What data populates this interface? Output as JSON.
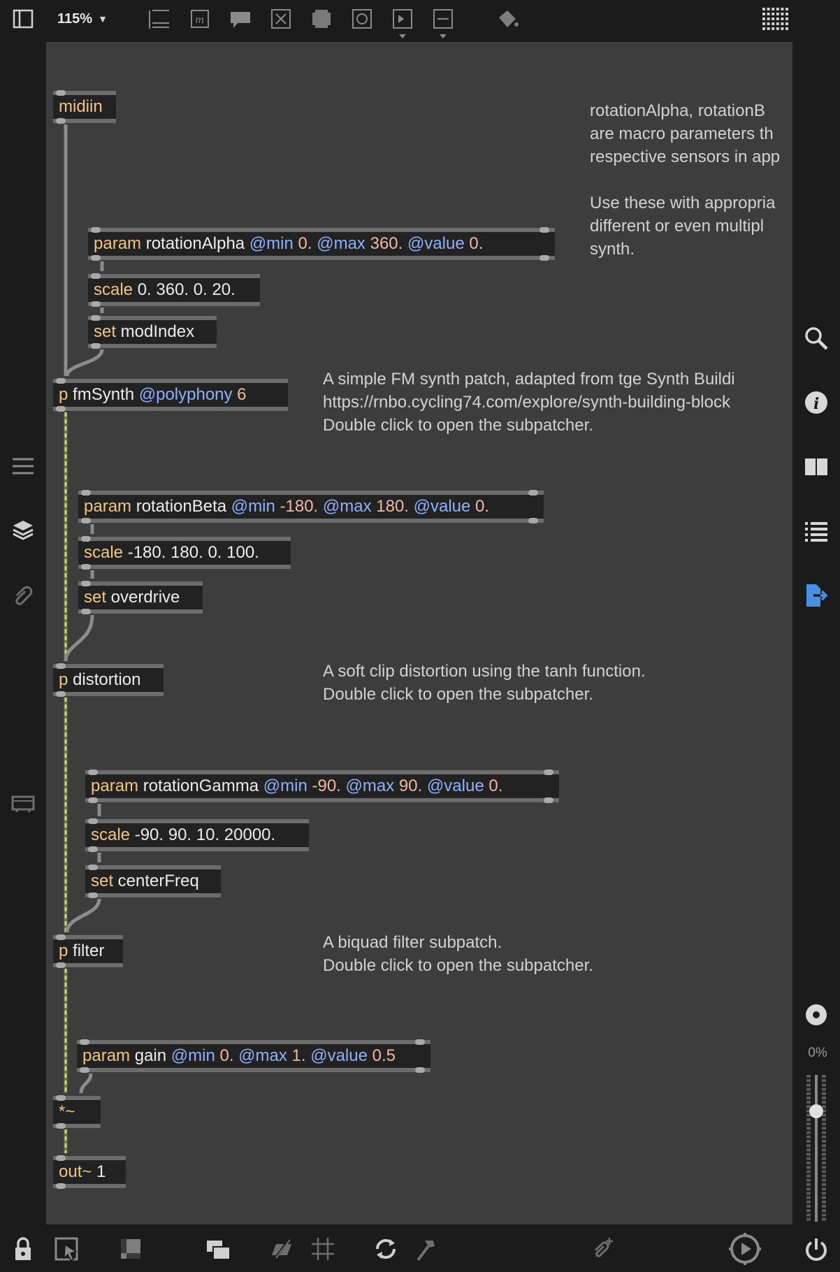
{
  "toolbar": {
    "zoom_label": "115%",
    "zoom_caret": "▼",
    "icons": [
      "sidebar-toggle-icon",
      "presentation-icon",
      "message-icon",
      "comment-icon",
      "button-icon",
      "toggle-icon",
      "number-box-icon",
      "play-icon",
      "slider-icon",
      "paint-bucket-icon",
      "grid-menu-icon"
    ]
  },
  "left_sidebar": {
    "icons": [
      "list-icon",
      "layers-icon",
      "attach-icon",
      "device-icon"
    ]
  },
  "right_sidebar": {
    "icons": [
      "search-icon",
      "info-icon",
      "book-icon",
      "list-icon",
      "export-icon",
      "record-icon"
    ],
    "meter_label": "0%"
  },
  "bottombar": {
    "icons": [
      "lock-icon",
      "pointer-icon",
      "present-icon",
      "stack-icon",
      "hide-icon",
      "grid-icon",
      "refresh-icon",
      "hammer-icon",
      "clip-icon",
      "audio-icon",
      "power-icon"
    ]
  },
  "patch": {
    "midiin": {
      "cls": "midiin"
    },
    "param_alpha": {
      "cls": "param",
      "name": " rotationAlpha ",
      "a1": "@min",
      "v1": " 0. ",
      "a2": "@max",
      "v2": " 360. ",
      "a3": "@value",
      "v3": " 0."
    },
    "scale_alpha": {
      "cls": "scale",
      "args": " 0. 360. 0. 20."
    },
    "set_mod": {
      "cls": "set",
      "args": " modIndex"
    },
    "fmsynth": {
      "cls": "p",
      "name": " fmSynth ",
      "a1": "@polyphony",
      "v1": " 6"
    },
    "param_beta": {
      "cls": "param",
      "name": " rotationBeta ",
      "a1": "@min",
      "v1": " -180. ",
      "a2": "@max",
      "v2": " 180. ",
      "a3": "@value",
      "v3": " 0."
    },
    "scale_beta": {
      "cls": "scale",
      "args": " -180. 180. 0. 100."
    },
    "set_od": {
      "cls": "set",
      "args": " overdrive"
    },
    "distortion": {
      "cls": "p",
      "args": " distortion"
    },
    "param_gamma": {
      "cls": "param",
      "name": " rotationGamma ",
      "a1": "@min",
      "v1": " -90. ",
      "a2": "@max",
      "v2": " 90. ",
      "a3": "@value",
      "v3": " 0."
    },
    "scale_gamma": {
      "cls": "scale",
      "args": " -90. 90. 10. 20000."
    },
    "set_cf": {
      "cls": "set",
      "args": " centerFreq"
    },
    "filter": {
      "cls": "p",
      "args": " filter"
    },
    "param_gain": {
      "cls": "param",
      "name": " gain ",
      "a1": "@min",
      "v1": " 0. ",
      "a2": "@max",
      "v2": " 1. ",
      "a3": "@value",
      "v3": " 0.5"
    },
    "mult": {
      "cls": "*~"
    },
    "out": {
      "cls": "out~",
      "args": " 1"
    }
  },
  "comments": {
    "macro": "rotationAlpha, rotationB\nare macro parameters th\nrespective sensors in app\n\nUse these with appropria\ndifferent or even multipl\nsynth.",
    "fm": "A simple FM synth patch, adapted from tge Synth Buildi\nhttps://rnbo.cycling74.com/explore/synth-building-block\nDouble click to open the subpatcher.",
    "distortion": "A soft clip distortion using the tanh function.\nDouble click to open the subpatcher.",
    "filter": "A biquad filter subpatch.\nDouble click to open the subpatcher."
  },
  "colors": {
    "canvas": "#3d3d3d",
    "object_bg": "#222222",
    "object_border": "#6c6c6c",
    "class": "#f2c681",
    "attribute": "#8fb0ff",
    "number": "#f0b9a3",
    "signal_cord": "#d9e08a",
    "accent": "#4a90e2"
  }
}
